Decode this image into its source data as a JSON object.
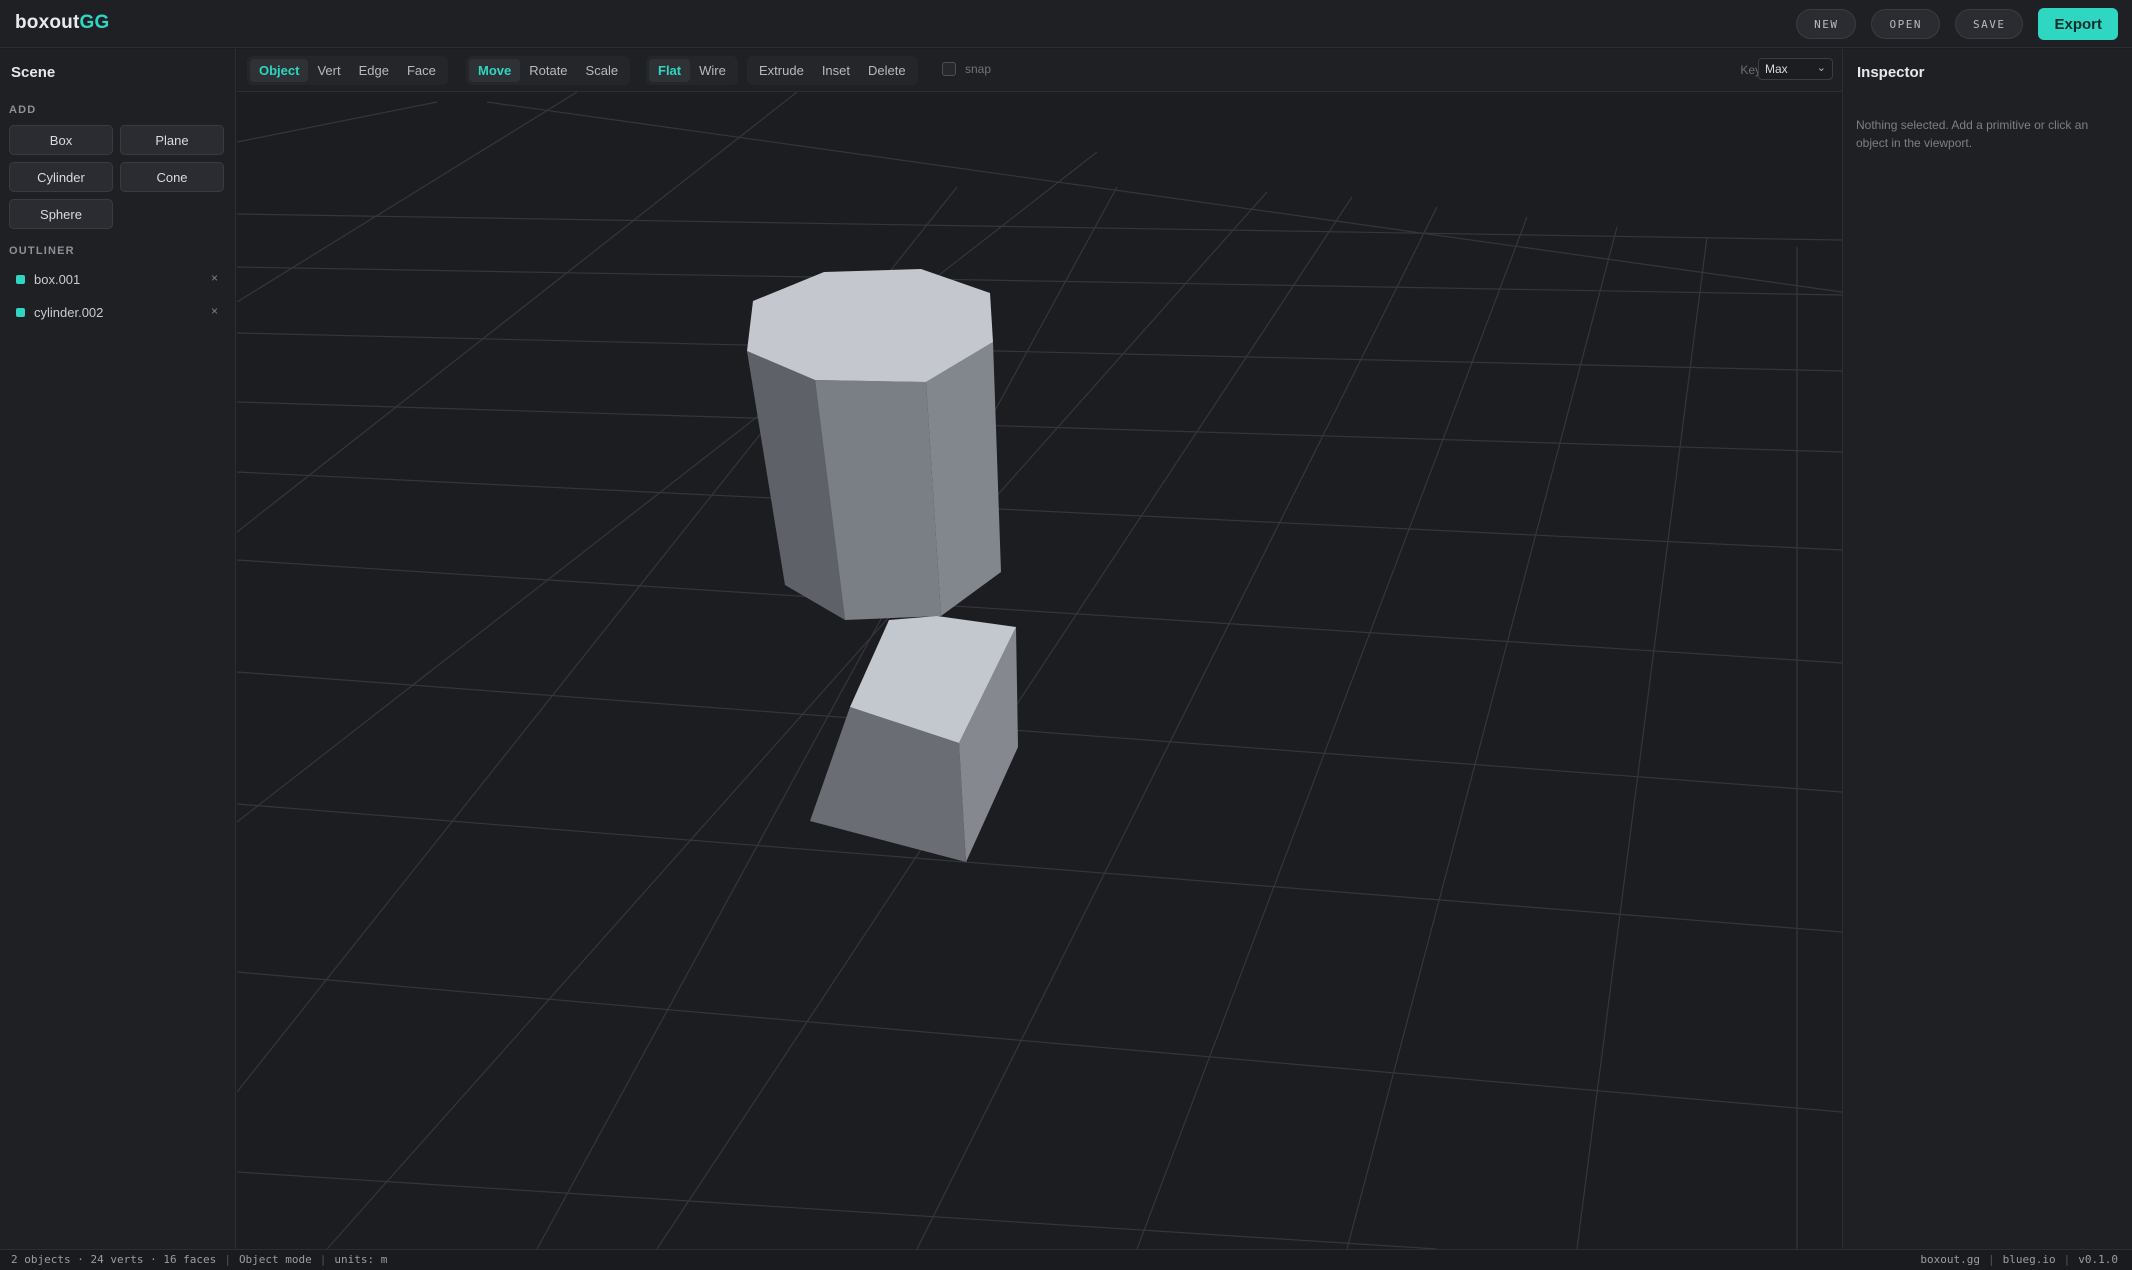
{
  "app": {
    "logo_main": "boxout",
    "logo_accent": "GG"
  },
  "topbar": {
    "new_label": "NEW",
    "open_label": "OPEN",
    "save_label": "SAVE",
    "export_label": "Export"
  },
  "scene": {
    "title": "Scene",
    "add_label": "ADD",
    "primitives": [
      "Box",
      "Plane",
      "Cylinder",
      "Cone",
      "Sphere"
    ],
    "outliner_label": "OUTLINER",
    "outliner": [
      {
        "name": "box.001",
        "remove": "×"
      },
      {
        "name": "cylinder.002",
        "remove": "×"
      }
    ]
  },
  "toolbar": {
    "select_modes": [
      "Object",
      "Vert",
      "Edge",
      "Face"
    ],
    "active_select_mode": "Object",
    "transform_tools": [
      "Move",
      "Rotate",
      "Scale"
    ],
    "active_transform": "Move",
    "shading": [
      "Flat",
      "Wire"
    ],
    "active_shading": "Flat",
    "operations": [
      "Extrude",
      "Inset",
      "Delete"
    ],
    "snap_label": "snap",
    "snap_checked": false,
    "keys_label": "Keys",
    "keys_value": "Max"
  },
  "inspector": {
    "title": "Inspector",
    "empty_message": "Nothing selected. Add a primitive or click an object in the viewport."
  },
  "status": {
    "counts": "2 objects · 24 verts · 16 faces",
    "mode": "Object mode",
    "units": "units: m",
    "links": [
      "boxout.gg",
      "blueg.io",
      "v0.1.0"
    ]
  },
  "colors": {
    "accent": "#2fd6c2",
    "background": "#1c1d20",
    "panel": "#1f2024",
    "mesh_top": "#c3c7ce",
    "mesh_side_light": "#7c8087",
    "mesh_side_dark": "#5e6168"
  }
}
